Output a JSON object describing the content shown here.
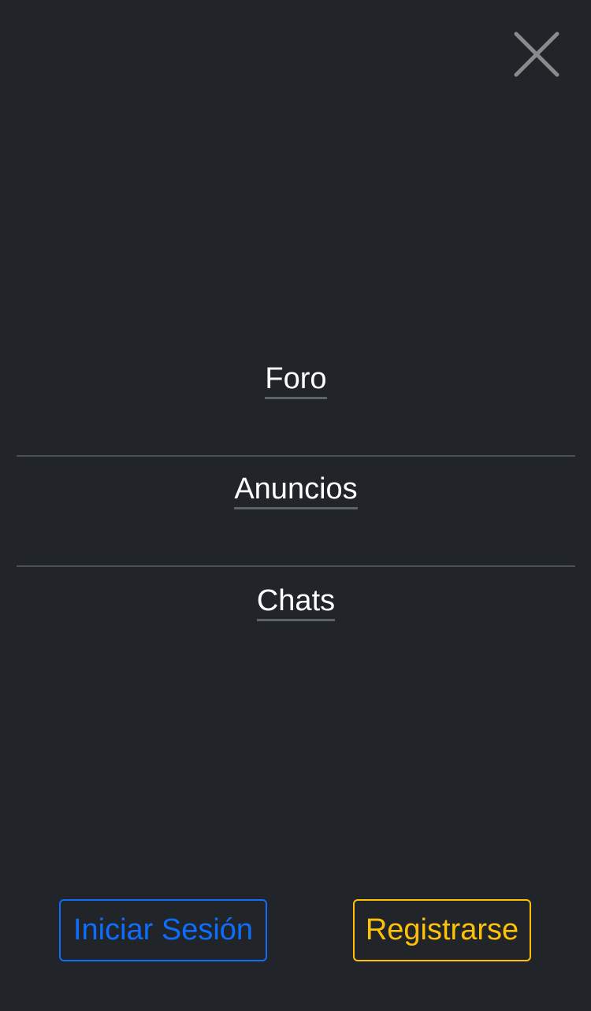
{
  "close_button": {
    "icon": "close-icon",
    "color": "#8a8a8a"
  },
  "nav": {
    "items": [
      {
        "label": "Foro"
      },
      {
        "label": "Anuncios"
      },
      {
        "label": "Chats"
      }
    ]
  },
  "actions": {
    "login_label": "Iniciar Sesión",
    "register_label": "Registrarse"
  },
  "colors": {
    "background": "#212529",
    "primary": "#0d6efd",
    "warning": "#ffc107",
    "divider": "#495057"
  }
}
